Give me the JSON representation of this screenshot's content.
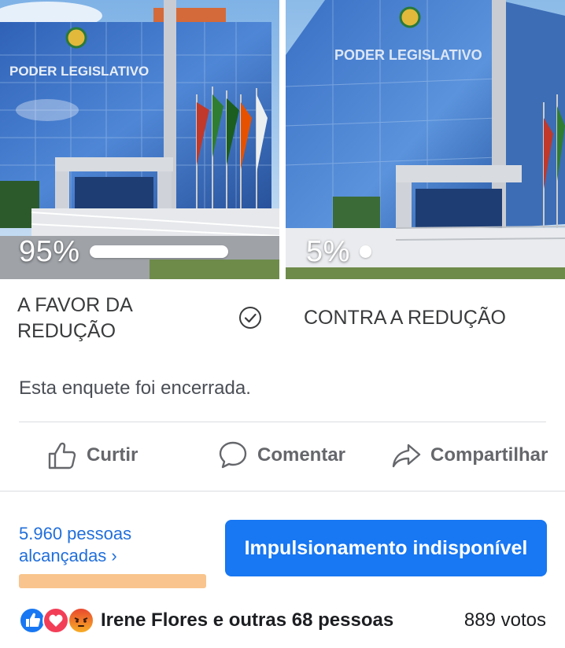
{
  "poll": {
    "options": [
      {
        "label": "A FAVOR DA REDUÇÃO",
        "percent_label": "95%",
        "percent": 95,
        "selected": true,
        "image_sign_text": "PODER LEGISLATIVO"
      },
      {
        "label": "CONTRA A REDUÇÃO",
        "percent_label": "5%",
        "percent": 5,
        "selected": false,
        "image_sign_text": "PODER LEGISLATIVO"
      }
    ],
    "status_text": "Esta enquete foi encerrada."
  },
  "actions": {
    "like_label": "Curtir",
    "comment_label": "Comentar",
    "share_label": "Compartilhar"
  },
  "reach": {
    "line1": "5.960 pessoas",
    "line2": "alcançadas ›"
  },
  "boost_button": {
    "label": "Impulsionamento indisponível"
  },
  "footer": {
    "reaction_icons": [
      "like-icon",
      "love-icon",
      "angry-icon"
    ],
    "reactors_text": "Irene Flores e outras 68 pessoas",
    "votes_text": "889 votos"
  },
  "colors": {
    "accent": "#1877f2",
    "link": "#216fdb",
    "reach_bar": "#f9c48d"
  }
}
